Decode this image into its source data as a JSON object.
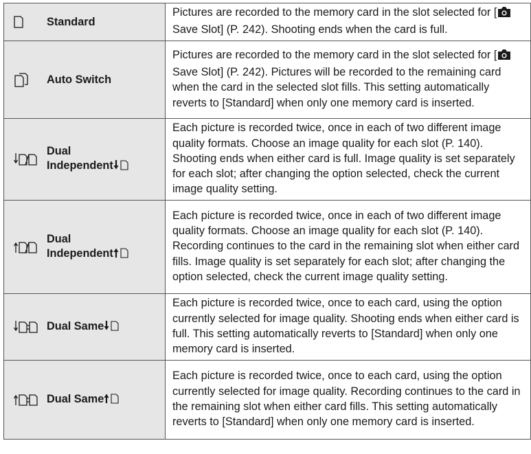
{
  "rows": [
    {
      "label": "Standard",
      "icon": "single-card-icon",
      "desc": [
        "Pictures are recorded to the memory card in the slot selected for [",
        "Save Slot] (P. 242). Shooting ends when the card is full."
      ]
    },
    {
      "label": "Auto Switch",
      "icon": "auto-switch-icon",
      "desc": [
        "Pictures are recorded to the memory card in the slot selected for [",
        "Save Slot] (P. 242). Pictures will be recorded to the remaining card when the card in the selected slot fills. This setting automatically reverts to [Standard] when only one memory card is inserted."
      ]
    },
    {
      "label_line1": "Dual",
      "label_line2": "Independent",
      "icon": "dual-independent-down-icon",
      "suffix_icon": "arrow-down-card-icon",
      "desc": "Each picture is recorded twice, once in each of two different image quality formats. Choose an image quality for each slot (P. 140). Shooting ends when either card is full. Image quality is set separately for each slot; after changing the option selected, check the current image quality setting."
    },
    {
      "label_line1": "Dual",
      "label_line2": "Independent",
      "icon": "dual-independent-up-icon",
      "suffix_icon": "arrow-up-card-icon",
      "desc": "Each picture is recorded twice, once in each of two different image quality formats. Choose an image quality for each slot (P. 140). Recording continues to the card in the remaining slot when either card fills. Image quality is set separately for each slot; after changing the option selected, check the current image quality setting."
    },
    {
      "label": "Dual Same",
      "icon": "dual-same-down-icon",
      "suffix_icon": "arrow-down-card-icon",
      "desc": "Each picture is recorded twice, once to each card, using the option currently selected for image quality. Shooting ends when either card is full. This setting automatically reverts to [Standard] when only one memory card is inserted."
    },
    {
      "label": "Dual Same",
      "icon": "dual-same-up-icon",
      "suffix_icon": "arrow-up-card-icon",
      "desc": "Each picture is recorded twice, once to each card, using the option currently selected for image quality. Recording continues to the card in the remaining slot when either card fills. This setting automatically reverts to [Standard] when only one memory card is inserted."
    }
  ],
  "colors": {
    "label_bg": "#e6e6e6",
    "border": "#555555",
    "text": "#1a1a1a"
  }
}
